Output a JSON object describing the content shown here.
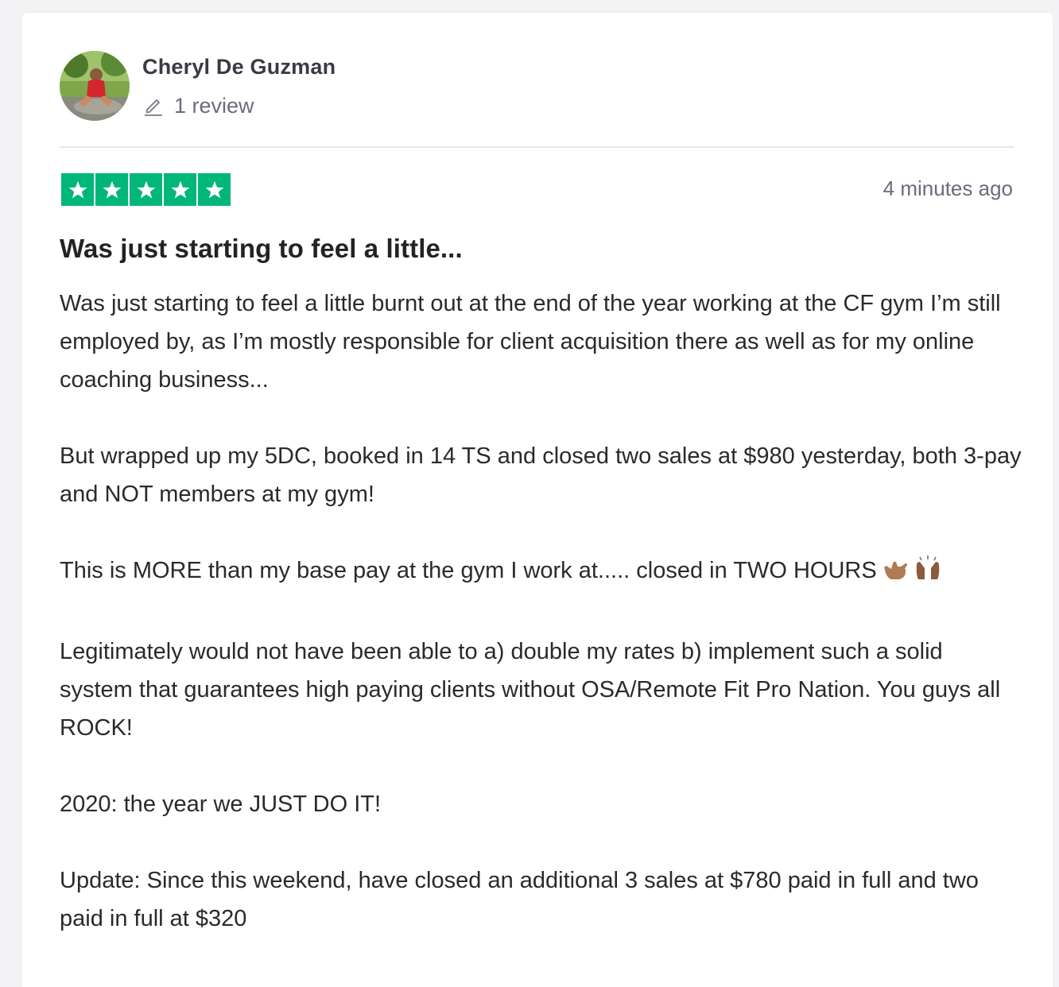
{
  "review": {
    "author": {
      "name": "Cheryl De Guzman",
      "review_count_label": "1 review",
      "review_icon": "pencil-icon"
    },
    "rating": {
      "stars": 5,
      "max": 5,
      "color": "#00b67a"
    },
    "timestamp": "4 minutes ago",
    "title": "Was just starting to feel a little...",
    "paragraphs": [
      "Was just starting to feel a little burnt out at the end of the year working at the CF gym I’m still employed by, as I’m mostly responsible for client acquisition there as well as for my online coaching business...",
      "But wrapped up my 5DC, booked in 14 TS and closed two sales at $980 yesterday, both 3-pay and NOT members at my gym!",
      "This is MORE than my base pay at the gym I work at..... closed in TWO HOURS",
      "Legitimately would not have been able to a) double my rates b) implement such a solid system that guarantees high paying clients without OSA/Remote Fit Pro Nation. You guys all ROCK!",
      "2020: the year we JUST DO IT!",
      "Update: Since this weekend, have closed an additional 3 sales at $780 paid in full and two paid in full at $320"
    ],
    "emojis": [
      "call-me-hand-emoji",
      "raising-hands-emoji"
    ]
  }
}
